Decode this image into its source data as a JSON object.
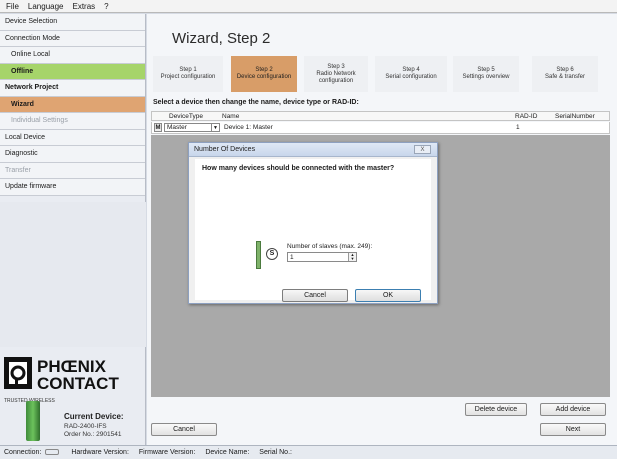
{
  "menu": [
    "File",
    "Language",
    "Extras",
    "?"
  ],
  "sidebar": {
    "items": [
      {
        "label": "Device Selection"
      },
      {
        "label": "Connection Mode"
      },
      {
        "label": "Online Local"
      },
      {
        "label": "Offline"
      },
      {
        "label": "Network Project"
      },
      {
        "label": "Wizard"
      },
      {
        "label": "Individual Settings"
      },
      {
        "label": "Local Device"
      },
      {
        "label": "Diagnostic"
      },
      {
        "label": "Transfer"
      },
      {
        "label": "Update firmware"
      }
    ],
    "logo_line1": "PHŒNIX",
    "logo_line2": "CONTACT",
    "trusted": "TRUSTED WIRELESS",
    "current_device_label": "Current Device:",
    "device_model": "RAD-2400-IFS",
    "device_order": "Order No.: 2901541"
  },
  "wizard": {
    "title": "Wizard, Step 2",
    "steps": [
      {
        "l1": "Step 1",
        "l2": "Project configuration",
        "l3": ""
      },
      {
        "l1": "Step 2",
        "l2": "Device configuration",
        "l3": ""
      },
      {
        "l1": "Step 3",
        "l2": "Radio Network",
        "l3": "configuration"
      },
      {
        "l1": "Step 4",
        "l2": "Serial configuration",
        "l3": ""
      },
      {
        "l1": "Step 5",
        "l2": "Settings overview",
        "l3": ""
      },
      {
        "l1": "Step 6",
        "l2": "Safe & transfer",
        "l3": ""
      }
    ],
    "select_label": "Select a device then change the name, device type or RAD-ID:",
    "table": {
      "headers": {
        "device_type": "DeviceType",
        "name": "Name",
        "rad_id": "RAD-ID",
        "serial": "SerialNumber"
      },
      "row": {
        "badge": "M",
        "device_type": "Master",
        "name": "Device 1: Master",
        "rad_id": "1",
        "serial": ""
      }
    },
    "delete_device": "Delete device",
    "add_device": "Add device",
    "cancel": "Cancel",
    "next": "Next"
  },
  "dialog": {
    "title": "Number Of Devices",
    "close": "X",
    "question": "How many devices should be connected with the master?",
    "slave_badge": "S",
    "slave_label": "Number of slaves (max. 249):",
    "slave_value": "1",
    "cancel": "Cancel",
    "ok": "OK"
  },
  "status": {
    "connection": "Connection:",
    "hardware": "Hardware Version:",
    "firmware": "Firmware Version:",
    "device_name": "Device Name:",
    "serial": "Serial No.:"
  }
}
